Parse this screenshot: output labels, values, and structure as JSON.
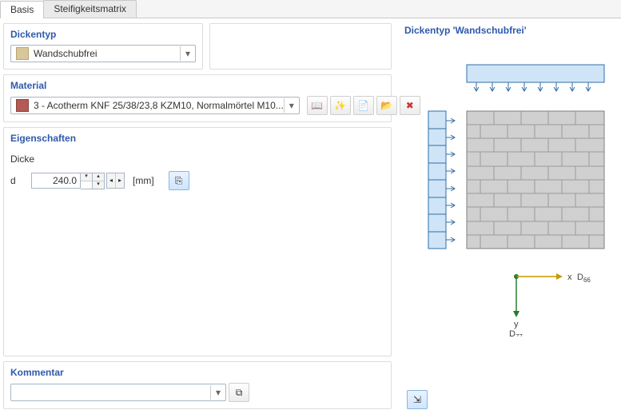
{
  "tabs": {
    "basis": "Basis",
    "stiff": "Steifigkeitsmatrix"
  },
  "dickentyp": {
    "title": "Dickentyp",
    "value": "Wandschubfrei"
  },
  "material": {
    "title": "Material",
    "value": "3 - Acotherm KNF 25/38/23,8 KZM10, Normalmörtel M10..."
  },
  "eigenschaften": {
    "title": "Eigenschaften"
  },
  "dicke": {
    "label": "Dicke",
    "symbol": "d",
    "value": "240.0",
    "unit": "[mm]"
  },
  "kommentar": {
    "title": "Kommentar"
  },
  "preview": {
    "title": "Dickentyp  'Wandschubfrei'",
    "x": "x",
    "y": "y",
    "d66": "D",
    "d66sub": "66",
    "d77": "D",
    "d77sub": "77"
  },
  "icons": {
    "book": "📖",
    "star": "✨",
    "boxnew": "📄",
    "boxopen": "📂",
    "del": "✖",
    "attach": "⎘",
    "copy": "⧉",
    "hl": "⇲"
  }
}
